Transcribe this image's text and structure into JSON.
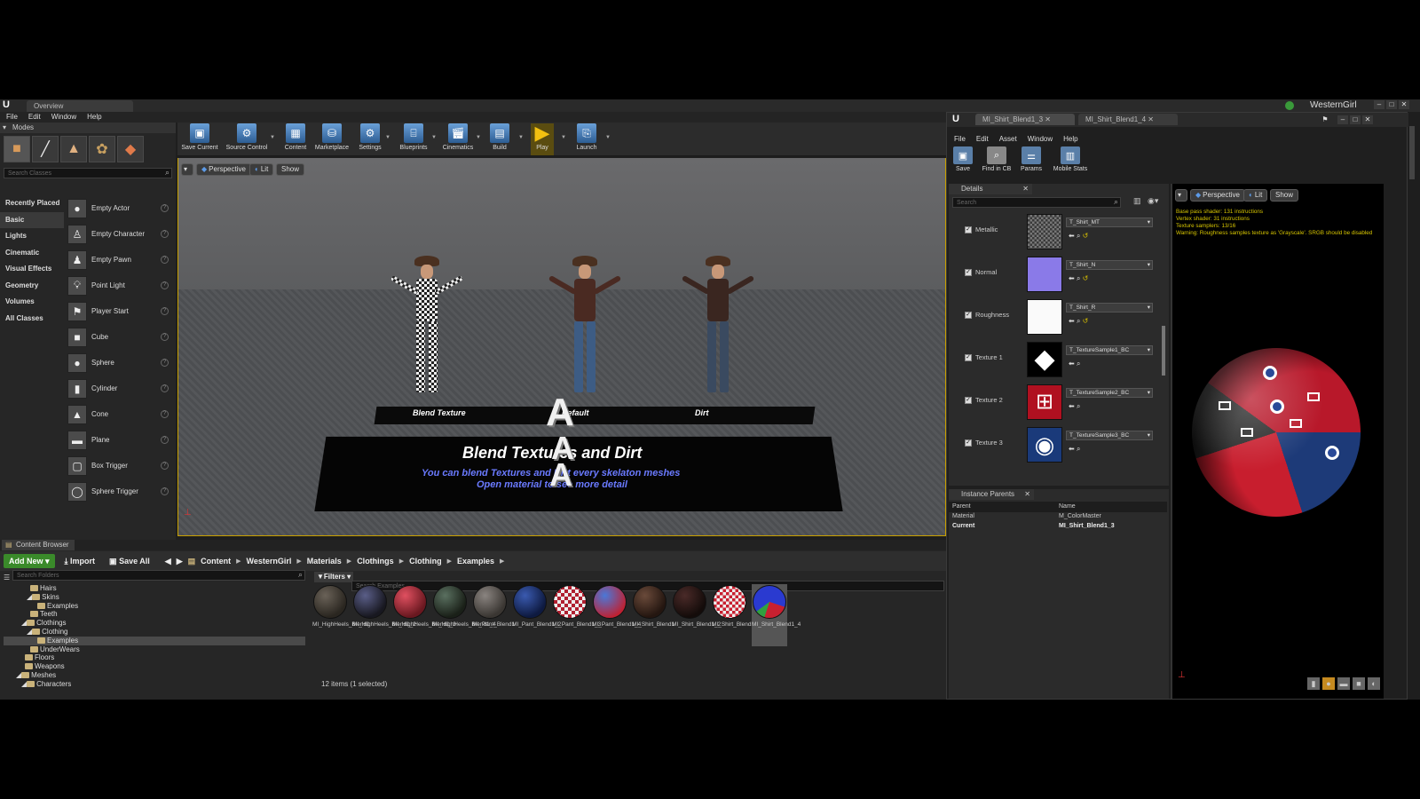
{
  "titlebar": {
    "tab": "Overview",
    "project": "WesternGirl"
  },
  "menu": [
    "File",
    "Edit",
    "Window",
    "Help"
  ],
  "modes": {
    "tab": "Modes",
    "search_placeholder": "Search Classes",
    "categories": [
      "Recently Placed",
      "Basic",
      "Lights",
      "Cinematic",
      "Visual Effects",
      "Geometry",
      "Volumes",
      "All Classes"
    ],
    "items": [
      "Empty Actor",
      "Empty Character",
      "Empty Pawn",
      "Point Light",
      "Player Start",
      "Cube",
      "Sphere",
      "Cylinder",
      "Cone",
      "Plane",
      "Box Trigger",
      "Sphere Trigger"
    ]
  },
  "toolbar": {
    "save_current": "Save Current",
    "source_control": "Source Control",
    "content": "Content",
    "marketplace": "Marketplace",
    "settings": "Settings",
    "blueprints": "Blueprints",
    "cinematics": "Cinematics",
    "build": "Build",
    "play": "Play",
    "launch": "Launch"
  },
  "viewport": {
    "perspective": "Perspective",
    "lit": "Lit",
    "show": "Show",
    "sign_labels": [
      "Blend Texture",
      "Default",
      "Dirt"
    ],
    "sign_title": "Blend Textures and Dirt",
    "sign_line1": "You can blend Textures and Dirt every skelaton meshes",
    "sign_line2": "Open material to see more detail"
  },
  "content_browser": {
    "tab": "Content Browser",
    "add_new": "Add New",
    "import": "Import",
    "save_all": "Save All",
    "path": [
      "Content",
      "WesternGirl",
      "Materials",
      "Clothings",
      "Clothing",
      "Examples"
    ],
    "search_folders": "Search Folders",
    "filters": "Filters",
    "search_examples": "Search Examples",
    "tree": [
      "Hairs",
      "Skins",
      "Examples",
      "Teeth",
      "Clothings",
      "Clothing",
      "Examples",
      "UnderWears",
      "Floors",
      "Weapons",
      "Meshes",
      "Characters"
    ],
    "assets": [
      "MI_HighHeels_Blend1",
      "MI_HighHeels_Blend1_2",
      "MI_HighHeels_Blend1_3",
      "MI_HighHeels_Blend1_4",
      "MI_Pant_Blend1",
      "MI_Pant_Blend1_2",
      "MI_Pant_Blend1_3",
      "MI_Pant_Blend1_4",
      "MI_Shirt_Blend1",
      "MI_Shirt_Blend1_2",
      "MI_Shirt_Blend1_3",
      "MI_Shirt_Blend1_4"
    ],
    "status": "12 items (1 selected)"
  },
  "material_editor": {
    "tabs": [
      "MI_Shirt_Blend1_3",
      "MI_Shirt_Blend1_4"
    ],
    "menu": [
      "File",
      "Edit",
      "Asset",
      "Window",
      "Help"
    ],
    "buttons": [
      "Save",
      "Find in CB",
      "Params",
      "Mobile Stats"
    ],
    "details_tab": "Details",
    "search_placeholder": "Search",
    "params": [
      {
        "name": "Metallic",
        "texture": "T_Shirt_MT"
      },
      {
        "name": "Normal",
        "texture": "T_Shirt_N"
      },
      {
        "name": "Roughness",
        "texture": "T_Shirt_R"
      },
      {
        "name": "Texture 1",
        "texture": "T_TextureSample1_BC"
      },
      {
        "name": "Texture 2",
        "texture": "T_TextureSample2_BC"
      },
      {
        "name": "Texture 3",
        "texture": "T_TextureSample3_BC"
      }
    ],
    "instance_parents_tab": "Instance Parents",
    "table_headers": [
      "Parent",
      "Name"
    ],
    "rows": [
      {
        "label": "Material",
        "value": "M_ColorMaster"
      },
      {
        "label": "Current",
        "value": "MI_Shirt_Blend1_3"
      }
    ],
    "preview": {
      "perspective": "Perspective",
      "lit": "Lit",
      "show": "Show",
      "stats": [
        "Base pass shader: 131 instructions",
        "Vertex shader: 31 instructions",
        "Texture samplers: 13/16",
        "Warning: Roughness samples texture as 'Grayscale'. SRGB should be disabled"
      ]
    }
  }
}
